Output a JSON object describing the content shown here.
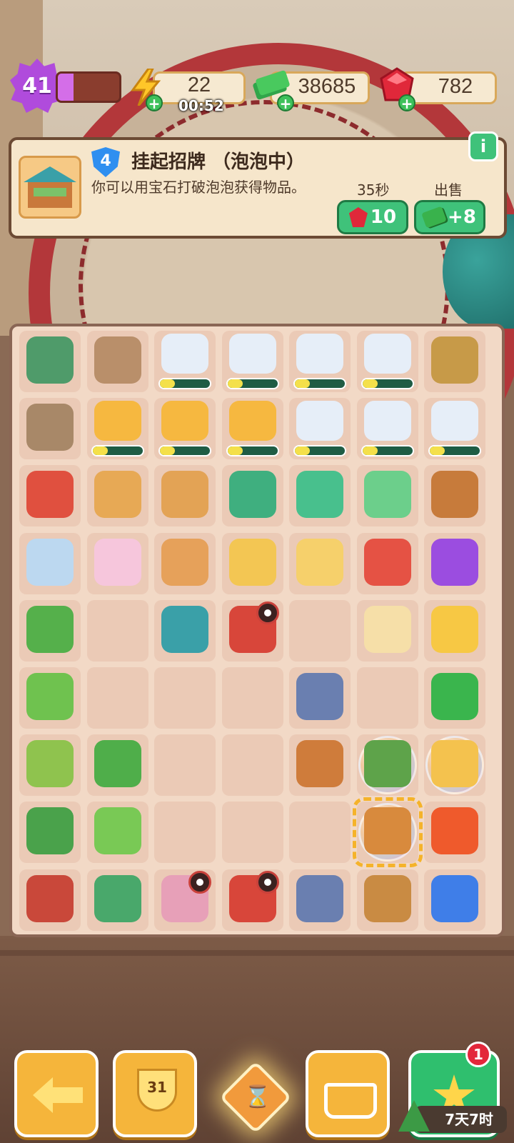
{
  "top_bar": {
    "level": "41",
    "xp_progress": 0.25,
    "energy": "22",
    "energy_timer": "00:52",
    "cash": "38685",
    "gems": "782"
  },
  "info_panel": {
    "item_level": "4",
    "title": "挂起招牌 （泡泡中）",
    "description": "你可以用宝石打破泡泡获得物品。",
    "pop_time_label": "35秒",
    "pop_cost": "10",
    "sell_label": "出售",
    "sell_value": "+8",
    "info_icon": "i"
  },
  "board": {
    "columns": 7,
    "rows": 9,
    "cells": [
      {
        "name": "zongzi-gift-box",
        "color": "#4f9b6a"
      },
      {
        "name": "hot-spring-mountain",
        "color": "#b98f6a"
      },
      {
        "name": "ink-brush",
        "color": "#e6eef8",
        "progress": 0.3
      },
      {
        "name": "ink-brush",
        "color": "#e6eef8",
        "progress": 0.3
      },
      {
        "name": "ink-brush",
        "color": "#e6eef8",
        "progress": 0.3
      },
      {
        "name": "ink-brush",
        "color": "#e6eef8",
        "progress": 0.3
      },
      {
        "name": "clay-pot",
        "color": "#c79a48"
      },
      {
        "name": "hot-spring-mountain",
        "color": "#a88868"
      },
      {
        "name": "worker-yellow-hat",
        "color": "#f6b840",
        "progress": 0.3
      },
      {
        "name": "worker-yellow-hat",
        "color": "#f6b840",
        "progress": 0.3
      },
      {
        "name": "worker-yellow-hat",
        "color": "#f6b840",
        "progress": 0.3
      },
      {
        "name": "ink-brush",
        "color": "#e6eef8",
        "progress": 0.3
      },
      {
        "name": "ink-brush",
        "color": "#e6eef8",
        "progress": 0.3
      },
      {
        "name": "ink-brush",
        "color": "#e6eef8",
        "progress": 0.3
      },
      {
        "name": "warrior",
        "color": "#e0503f"
      },
      {
        "name": "bamboo-steamer-leaf",
        "color": "#e7a955"
      },
      {
        "name": "bamboo-steamer",
        "color": "#e3a355"
      },
      {
        "name": "zongzi-bag",
        "color": "#3faf7f"
      },
      {
        "name": "lantern-bag",
        "color": "#48c08d"
      },
      {
        "name": "zongzi-bundle",
        "color": "#6ccf8b"
      },
      {
        "name": "hourglass",
        "color": "#c77b3b"
      },
      {
        "name": "ticket-blue",
        "color": "#bcd8f0"
      },
      {
        "name": "ticket-pink",
        "color": "#f6c6dc"
      },
      {
        "name": "knot-tile",
        "color": "#e6a15a"
      },
      {
        "name": "fabric-yellow-blue",
        "color": "#f3c653"
      },
      {
        "name": "fabric-yellow",
        "color": "#f6d06b"
      },
      {
        "name": "fabric-red",
        "color": "#e55244"
      },
      {
        "name": "purple-star",
        "color": "#9b4de0"
      },
      {
        "name": "grass-tuft",
        "color": "#55b04b"
      },
      {
        "name": "empty",
        "color": ""
      },
      {
        "name": "market-stall",
        "color": "#3aa0a8"
      },
      {
        "name": "red-gate-locked",
        "color": "#d8463a",
        "locked": true
      },
      {
        "name": "empty",
        "color": ""
      },
      {
        "name": "tofu-slice",
        "color": "#f6dfa8"
      },
      {
        "name": "moon-stars",
        "color": "#f7c844"
      },
      {
        "name": "sprout",
        "color": "#6fc24f"
      },
      {
        "name": "empty",
        "color": ""
      },
      {
        "name": "empty",
        "color": ""
      },
      {
        "name": "empty",
        "color": ""
      },
      {
        "name": "chinese-shop",
        "color": "#6a7fb0"
      },
      {
        "name": "empty",
        "color": ""
      },
      {
        "name": "cash-stack",
        "color": "#3ab54d"
      },
      {
        "name": "rice-plant",
        "color": "#8fc34e"
      },
      {
        "name": "leafy-plant",
        "color": "#4fae4a"
      },
      {
        "name": "empty",
        "color": ""
      },
      {
        "name": "empty",
        "color": ""
      },
      {
        "name": "wooden-box",
        "color": "#cf7c3b"
      },
      {
        "name": "zongzi-bubble",
        "color": "#5ea34a",
        "bubble": true
      },
      {
        "name": "moon-bubble",
        "color": "#f4c24e",
        "bubble": true
      },
      {
        "name": "reed-bush",
        "color": "#4aa24b"
      },
      {
        "name": "small-sprout",
        "color": "#79c955"
      },
      {
        "name": "empty",
        "color": ""
      },
      {
        "name": "empty",
        "color": ""
      },
      {
        "name": "empty",
        "color": ""
      },
      {
        "name": "market-stall-bubble",
        "color": "#d88a3d",
        "bubble": true,
        "selected": true
      },
      {
        "name": "energy-orb",
        "color": "#ef5a2c"
      },
      {
        "name": "retro-tv",
        "color": "#c9483a"
      },
      {
        "name": "landscape-card",
        "color": "#49a86b"
      },
      {
        "name": "blossom-village-locked",
        "color": "#e7a0b8",
        "locked": true
      },
      {
        "name": "red-gate-locked",
        "color": "#d8463a",
        "locked": true
      },
      {
        "name": "small-house",
        "color": "#6a7fb0"
      },
      {
        "name": "wood-logs",
        "color": "#c98b43"
      },
      {
        "name": "hourglass-gem",
        "color": "#3f7ee8"
      }
    ]
  },
  "bottom_bar": {
    "trophy_count": "31",
    "notification_count": "1",
    "event_timer": "7天7时",
    "center_glyph": "⌛"
  },
  "colors": {
    "accent_green": "#3fc27a",
    "gem_red": "#e0283a",
    "level_purple": "#b04bdc"
  }
}
